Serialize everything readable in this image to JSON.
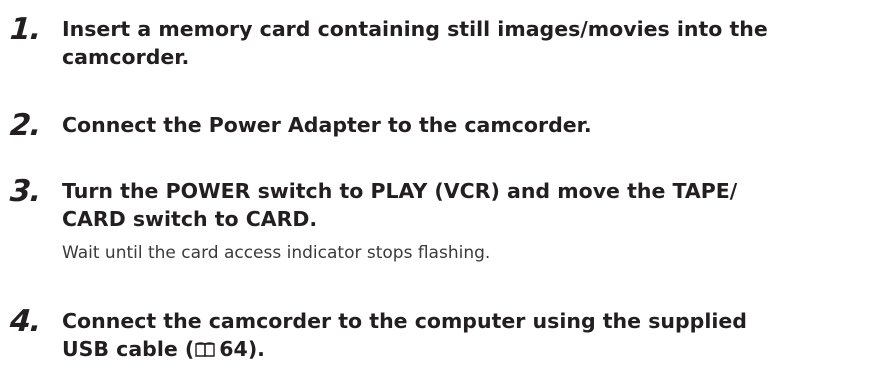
{
  "steps": [
    {
      "number": "1.",
      "lines": [
        "Insert a memory card containing still images/movies into the",
        "camcorder."
      ]
    },
    {
      "number": "2.",
      "lines": [
        "Connect the Power Adapter to the camcorder."
      ]
    },
    {
      "number": "3.",
      "lines": [
        "Turn the POWER switch to PLAY (VCR) and move the TAPE/",
        "CARD switch to CARD."
      ],
      "note": "Wait until the card access indicator stops flashing."
    },
    {
      "number": "4.",
      "lines": [
        "Connect the camcorder to the computer using the supplied"
      ],
      "line2_prefix": "USB cable (",
      "reference_icon": "book-reference-icon",
      "reference_page": "64",
      "line2_suffix": ")."
    }
  ]
}
